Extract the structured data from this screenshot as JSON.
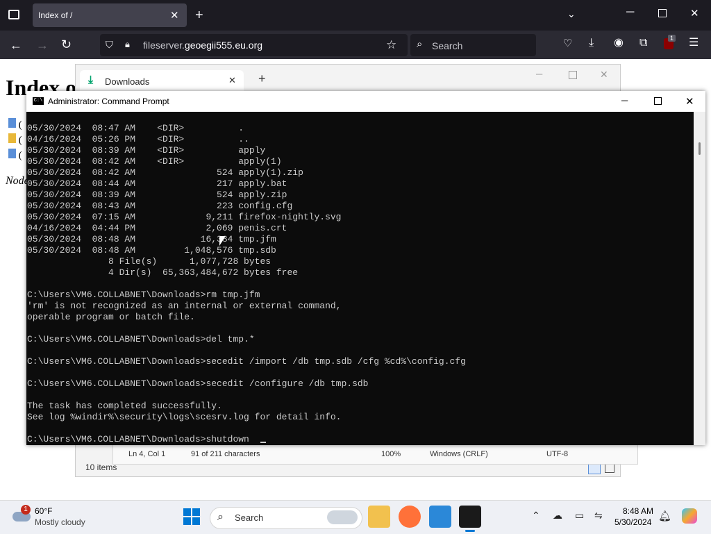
{
  "browser": {
    "tab_title": "Index of /",
    "url_prefix": "fileserver.",
    "url_domain": "geoegii555.eu.org",
    "search_placeholder": "Search",
    "extension_badge": "1"
  },
  "page": {
    "heading": "Index o",
    "list_fragments": [
      "(",
      "(",
      "("
    ],
    "footer_fragment": "Node"
  },
  "downloads_window": {
    "tab_title": "Downloads",
    "status_items": "10 items"
  },
  "notepad_status": {
    "position": "Ln 4, Col 1",
    "chars": "91 of 211 characters",
    "zoom": "100%",
    "line_ending": "Windows (CRLF)",
    "encoding": "UTF-8"
  },
  "cmd": {
    "title": "Administrator: Command Prompt",
    "icon_label": "C:\\",
    "console_text": "05/30/2024  08:47 AM    <DIR>          .\n04/16/2024  05:26 PM    <DIR>          ..\n05/30/2024  08:39 AM    <DIR>          apply\n05/30/2024  08:42 AM    <DIR>          apply(1)\n05/30/2024  08:42 AM               524 apply(1).zip\n05/30/2024  08:44 AM               217 apply.bat\n05/30/2024  08:39 AM               524 apply.zip\n05/30/2024  08:43 AM               223 config.cfg\n05/30/2024  07:15 AM             9,211 firefox-nightly.svg\n04/16/2024  04:44 PM             2,069 penis.crt\n05/30/2024  08:48 AM            16,384 tmp.jfm\n05/30/2024  08:48 AM         1,048,576 tmp.sdb\n               8 File(s)      1,077,728 bytes\n               4 Dir(s)  65,363,484,672 bytes free\n\nC:\\Users\\VM6.COLLABNET\\Downloads>rm tmp.jfm\n'rm' is not recognized as an internal or external command,\noperable program or batch file.\n\nC:\\Users\\VM6.COLLABNET\\Downloads>del tmp.*\n\nC:\\Users\\VM6.COLLABNET\\Downloads>secedit /import /db tmp.sdb /cfg %cd%\\config.cfg\n\nC:\\Users\\VM6.COLLABNET\\Downloads>secedit /configure /db tmp.sdb\n\nThe task has completed successfully.\nSee log %windir%\\security\\logs\\scesrv.log for detail info.\n\nC:\\Users\\VM6.COLLABNET\\Downloads>shutdown "
  },
  "taskbar": {
    "weather_temp": "60°F",
    "weather_desc": "Mostly cloudy",
    "weather_badge": "1",
    "search_placeholder": "Search",
    "time": "8:48 AM",
    "date": "5/30/2024"
  },
  "colors": {
    "firefox_dark": "#1c1b22",
    "firefox_toolbar": "#2b2a33",
    "console_bg": "#0c0c0c",
    "console_fg": "#cccccc",
    "taskbar_bg": "#eef0f5",
    "download_accent": "#00a36c"
  }
}
